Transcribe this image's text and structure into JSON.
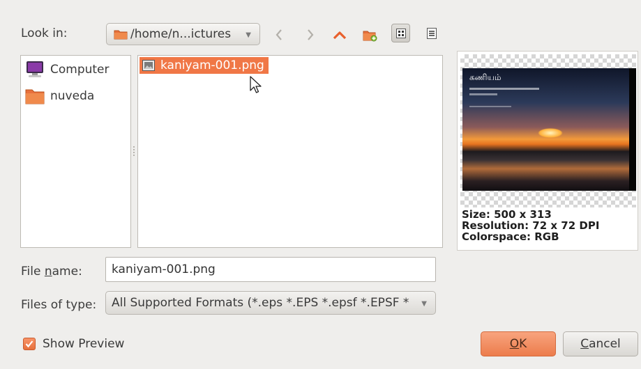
{
  "look_in": {
    "label": "Look in:",
    "path": "/home/n...ictures"
  },
  "toolbar": {
    "back_icon": "chevron-left-icon",
    "forward_icon": "chevron-right-icon",
    "up_icon": "up-arrow-icon",
    "new_folder_icon": "new-folder-icon",
    "icon_view_icon": "icon-view-icon",
    "detail_view_icon": "detail-view-icon"
  },
  "places": [
    {
      "label": "Computer",
      "icon": "computer-icon"
    },
    {
      "label": "nuveda",
      "icon": "folder-icon"
    }
  ],
  "files": [
    {
      "name": "kaniyam-001.png",
      "selected": true
    }
  ],
  "preview": {
    "thumb_title": "கணியம்",
    "size": "Size: 500 x 313",
    "resolution": "Resolution: 72 x 72 DPI",
    "colorspace": "Colorspace: RGB"
  },
  "file_name": {
    "label_pre": "File ",
    "label_u": "n",
    "label_post": "ame:",
    "value": "kaniyam-001.png"
  },
  "file_type": {
    "label": "Files of type:",
    "value": "All Supported Formats (*.eps *.EPS *.epsf *.EPSF *"
  },
  "show_preview": {
    "label": "Show Preview",
    "checked": true
  },
  "buttons": {
    "ok_u": "O",
    "ok_rest": "K",
    "cancel_u": "C",
    "cancel_rest": "ancel"
  },
  "colors": {
    "accent": "#f07746",
    "background": "#efeeec"
  }
}
